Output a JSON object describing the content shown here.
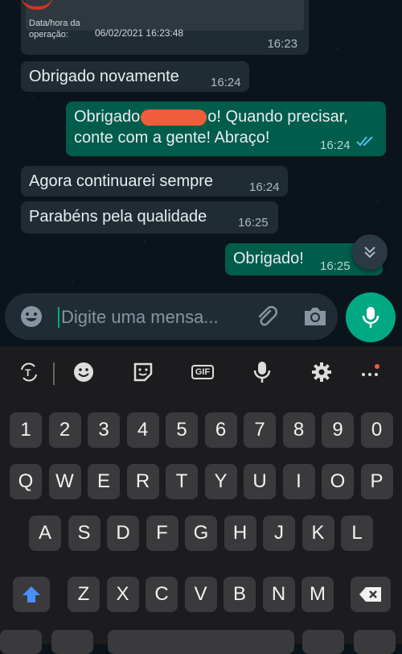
{
  "receipt": {
    "label": "Data/hora da operação:",
    "value": "06/02/2021 16:23:48",
    "time": "16:23"
  },
  "messages": [
    {
      "text": "Obrigado novamente",
      "time": "16:24"
    },
    {
      "text_before": "Obrigado",
      "text_after": "o! Quando precisar,",
      "line2": "conte com a gente! Abraço!",
      "time": "16:24"
    },
    {
      "text": "Agora continuarei sempre",
      "time": "16:24"
    },
    {
      "text": "Parabéns pela qualidade",
      "time": "16:25"
    },
    {
      "text": "Obrigado!",
      "time": "16:25"
    }
  ],
  "input": {
    "placeholder": "Digite uma mensa..."
  },
  "keyboard": {
    "gif_label": "GIF",
    "row_numbers": [
      "1",
      "2",
      "3",
      "4",
      "5",
      "6",
      "7",
      "8",
      "9",
      "0"
    ],
    "row_q": [
      "Q",
      "W",
      "E",
      "R",
      "T",
      "Y",
      "U",
      "I",
      "O",
      "P"
    ],
    "row_a": [
      "A",
      "S",
      "D",
      "F",
      "G",
      "H",
      "J",
      "K",
      "L"
    ],
    "row_z": [
      "Z",
      "X",
      "C",
      "V",
      "B",
      "N",
      "M"
    ]
  },
  "colors": {
    "accent": "#00a884",
    "outgoing_bubble": "#005c4b",
    "incoming_bubble": "#202c33",
    "read_ticks": "#53bdeb"
  }
}
